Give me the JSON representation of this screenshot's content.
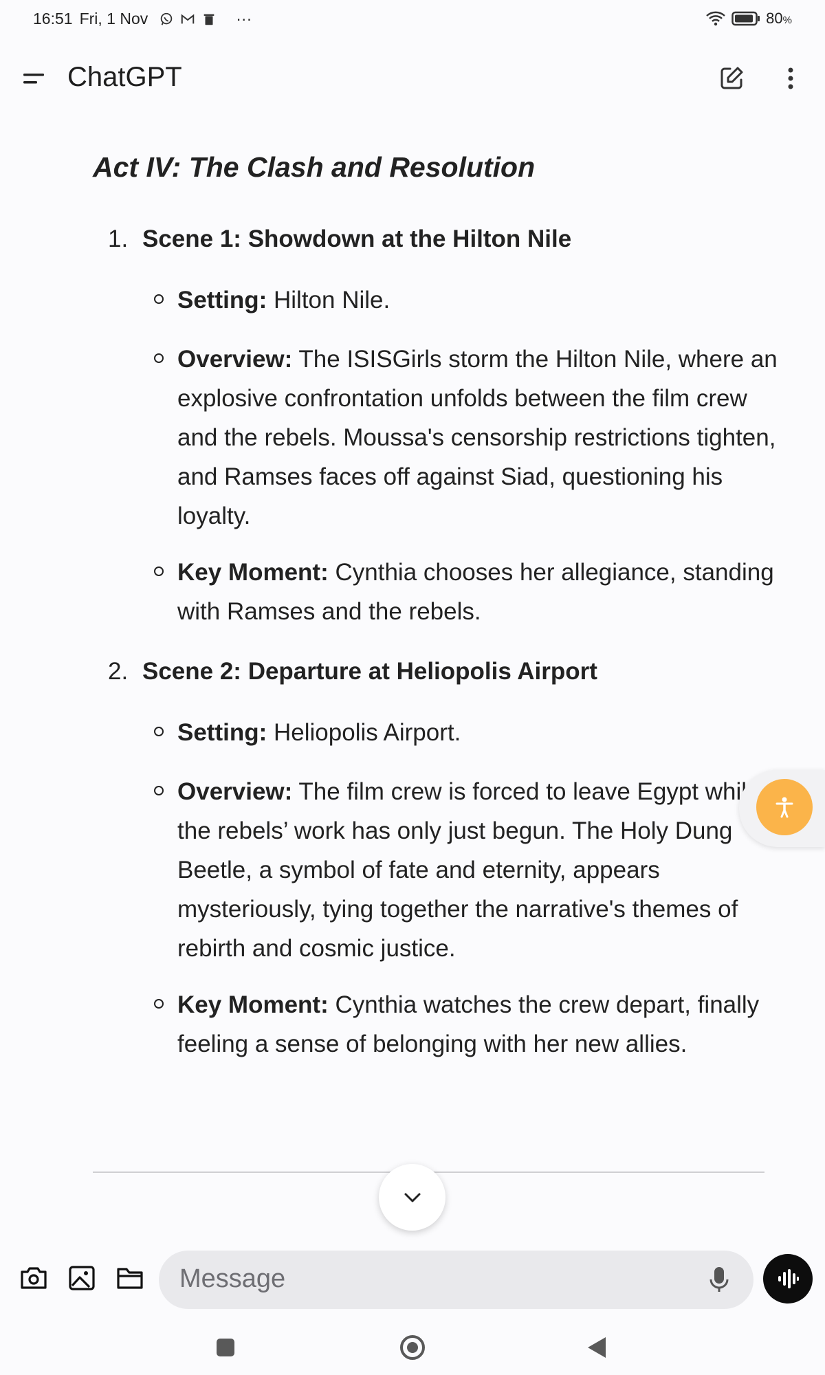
{
  "status_bar": {
    "time": "16:51",
    "date": "Fri, 1 Nov",
    "more": "···",
    "battery": "80",
    "battery_unit": "%"
  },
  "app": {
    "title": "ChatGPT"
  },
  "act": {
    "title": "Act IV: The Clash and Resolution",
    "scenes": [
      {
        "num": "1.",
        "heading": "Scene 1: Showdown at the Hilton Nile",
        "bullets": [
          {
            "label": "Setting:",
            "text": "Hilton Nile."
          },
          {
            "label": "Overview:",
            "text": "The ISISGirls storm the Hilton Nile, where an explosive confrontation unfolds between the film crew and the rebels. Moussa's censorship restrictions tighten, and Ramses faces off against Siad, questioning his loyalty."
          },
          {
            "label": "Key Moment:",
            "text": "Cynthia chooses her allegiance, standing with Ramses and the rebels."
          }
        ]
      },
      {
        "num": "2.",
        "heading": "Scene 2: Departure at Heliopolis Airport",
        "bullets": [
          {
            "label": "Setting:",
            "text": "Heliopolis Airport."
          },
          {
            "label": "Overview:",
            "text": "The film crew is forced to leave Egypt while the rebels’ work has only just begun. The Holy Dung Beetle, a symbol of fate and eternity, appears mysteriously, tying together the narrative's themes of rebirth and cosmic justice."
          },
          {
            "label": "Key Moment:",
            "text": "Cynthia watches the crew depart, finally feeling a sense of belonging with her new allies."
          }
        ]
      }
    ]
  },
  "composer": {
    "placeholder": "Message"
  },
  "colors": {
    "accessibility": "#fbb44a",
    "voice_button": "#0d0d0d"
  }
}
